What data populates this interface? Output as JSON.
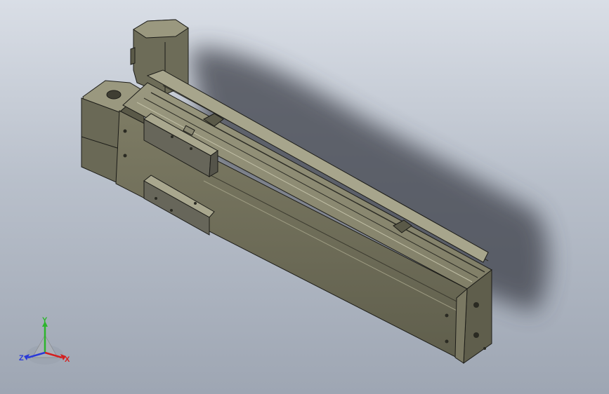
{
  "viewport": {
    "background_top": "#d9dee6",
    "background_bottom": "#9ea6b3"
  },
  "model": {
    "body_color": "#76755f",
    "body_light": "#8f8d74",
    "body_dark": "#4b4a3c",
    "edge_color": "#1c1c18",
    "shadow_color": "#3c4049"
  },
  "triad": {
    "x_label": "X",
    "y_label": "Y",
    "z_label": "Z",
    "x_color": "#d42020",
    "y_color": "#2db52d",
    "z_color": "#2a3ad8"
  }
}
